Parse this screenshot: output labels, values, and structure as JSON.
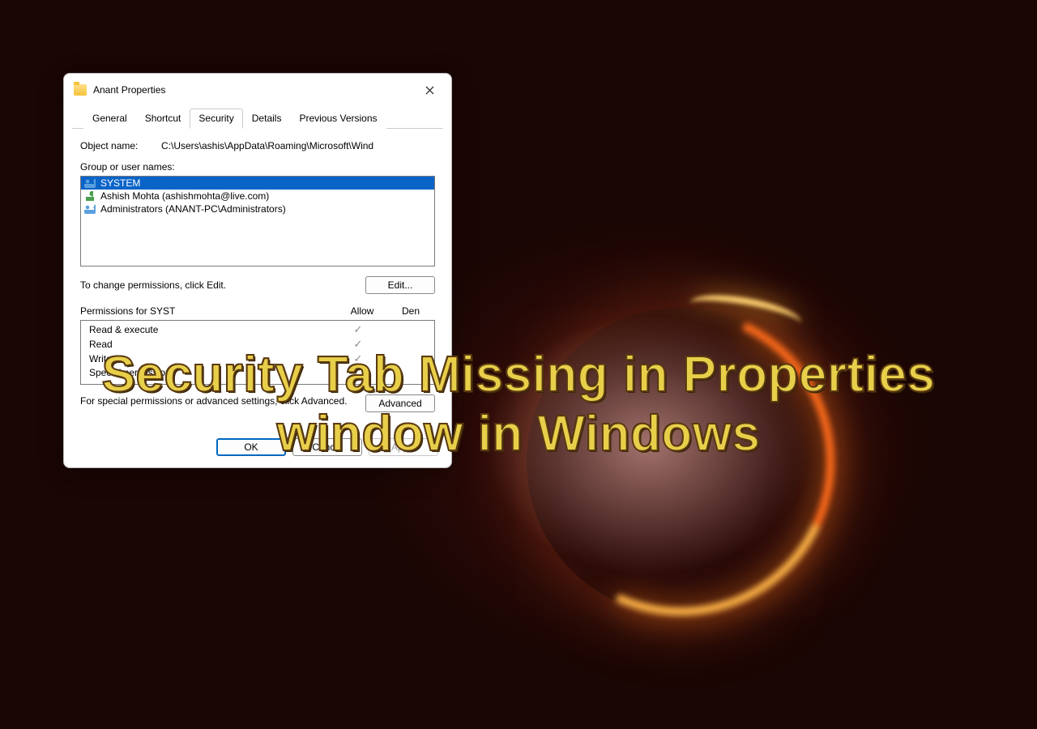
{
  "dialog": {
    "title": "Anant Properties",
    "tabs": [
      "General",
      "Shortcut",
      "Security",
      "Details",
      "Previous Versions"
    ],
    "active_tab_index": 2,
    "object_name_label": "Object name:",
    "object_name_value": "C:\\Users\\ashis\\AppData\\Roaming\\Microsoft\\Wind",
    "group_label": "Group or user names:",
    "users": [
      {
        "name": "SYSTEM",
        "icon": "group",
        "selected": true
      },
      {
        "name": "Ashish Mohta (ashishmohta@live.com)",
        "icon": "single",
        "selected": false
      },
      {
        "name": "Administrators (ANANT-PC\\Administrators)",
        "icon": "group",
        "selected": false
      }
    ],
    "edit_hint": "To change permissions, click Edit.",
    "edit_button": "Edit...",
    "perm_header": "Permissions for SYST",
    "allow_label": "Allow",
    "deny_label": "Den",
    "permissions": [
      {
        "name": "Read & execute",
        "allow": true,
        "deny": false
      },
      {
        "name": "Read",
        "allow": true,
        "deny": false
      },
      {
        "name": "Write",
        "allow": true,
        "deny": false
      },
      {
        "name": "Special permissions",
        "allow": false,
        "deny": false
      }
    ],
    "advanced_hint": "For special permissions or advanced settings, click Advanced.",
    "advanced_button": "Advanced",
    "ok": "OK",
    "cancel": "Cancel",
    "apply": "Apply"
  },
  "headline": {
    "line1": "Security Tab Missing in Properties",
    "line2": "window in Windows"
  }
}
